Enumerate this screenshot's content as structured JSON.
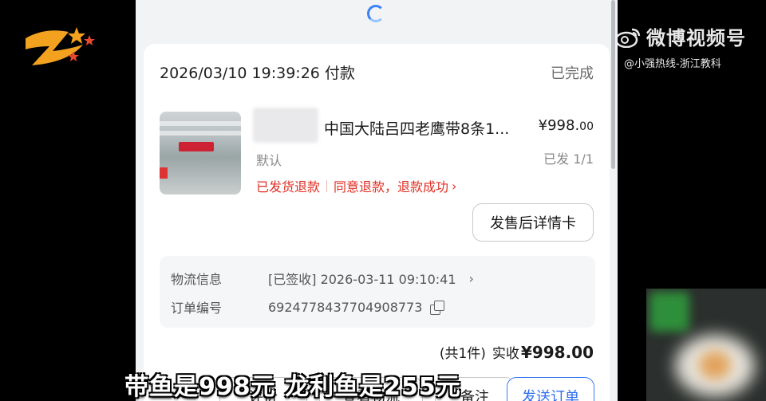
{
  "watermark": {
    "brand": "微博视频号",
    "handle": "@小强热线-浙江教科"
  },
  "order": {
    "pay_time": "2026/03/10 19:39:26 付款",
    "status": "已完成",
    "product_title": "中国大陆吕四老鹰带8条1...",
    "price_main": "¥998.",
    "price_cents": "00",
    "spec": "默认",
    "shipped": "已发 1/1",
    "refund": {
      "part1": "已发货退款",
      "part2": "同意退款，退款成功",
      "chevron": "›"
    },
    "after_sale_button": "发售后详情卡",
    "logistics_label": "物流信息",
    "logistics_value": "[已签收] 2026-03-11 09:10:41",
    "order_no_label": "订单编号",
    "order_no_value": "6924778437704908773",
    "total_count": "(共1件)",
    "total_label": "实收",
    "total_amount": "¥998.00",
    "buttons": [
      "评价",
      "查看物流",
      "备注",
      "发送订单"
    ]
  },
  "subtitle": "带鱼是998元 龙利鱼是255元",
  "colors": {
    "refund_red": "#e02e24",
    "primary_blue": "#2f6ef0"
  }
}
